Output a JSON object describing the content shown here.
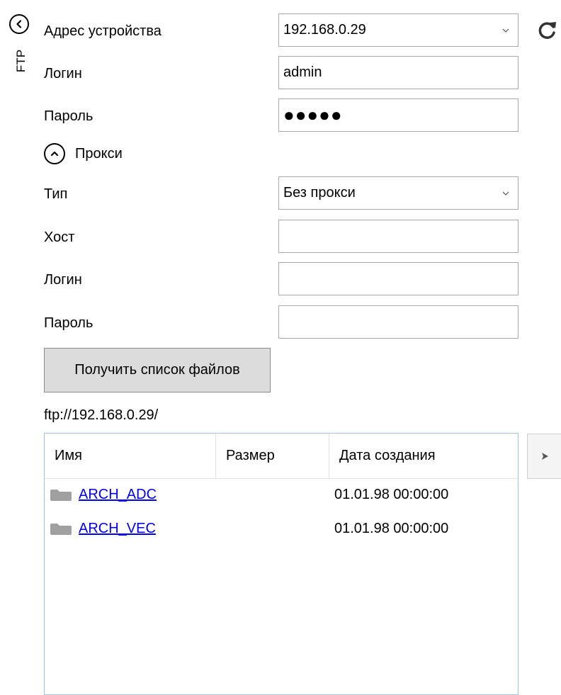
{
  "rail": {
    "back_icon": "chevron-left-icon",
    "vertical_label": "FTP",
    "refresh_icon": "refresh-icon"
  },
  "connection": {
    "address_label": "Адрес устройства",
    "address_value": "192.168.0.29",
    "login_label": "Логин",
    "login_value": "admin",
    "password_label": "Пароль",
    "password_dots": "●●●●●"
  },
  "proxy": {
    "toggle_label": "Прокси",
    "toggle_icon": "chevron-up-icon",
    "type_label": "Тип",
    "type_value": "Без прокси",
    "host_label": "Хост",
    "host_value": "",
    "login_label": "Логин",
    "login_value": "",
    "password_label": "Пароль",
    "password_value": ""
  },
  "actions": {
    "get_files_label": "Получить список файлов"
  },
  "path": "ftp://192.168.0.29/",
  "files": {
    "columns": [
      "Имя",
      "Размер",
      "Дата создания"
    ],
    "rows": [
      {
        "name": "ARCH_ADC",
        "size": "",
        "date": "01.01.98 00:00:00",
        "icon": "folder-icon"
      },
      {
        "name": "ARCH_VEC",
        "size": "",
        "date": "01.01.98 00:00:00",
        "icon": "folder-icon"
      }
    ],
    "side_button_icon": "arrow-right-icon"
  },
  "colors": {
    "link": "#0000ee",
    "button_bg": "#dcdcdc",
    "field_border": "#a9a9a9",
    "grid_border": "#a0c4e4"
  }
}
